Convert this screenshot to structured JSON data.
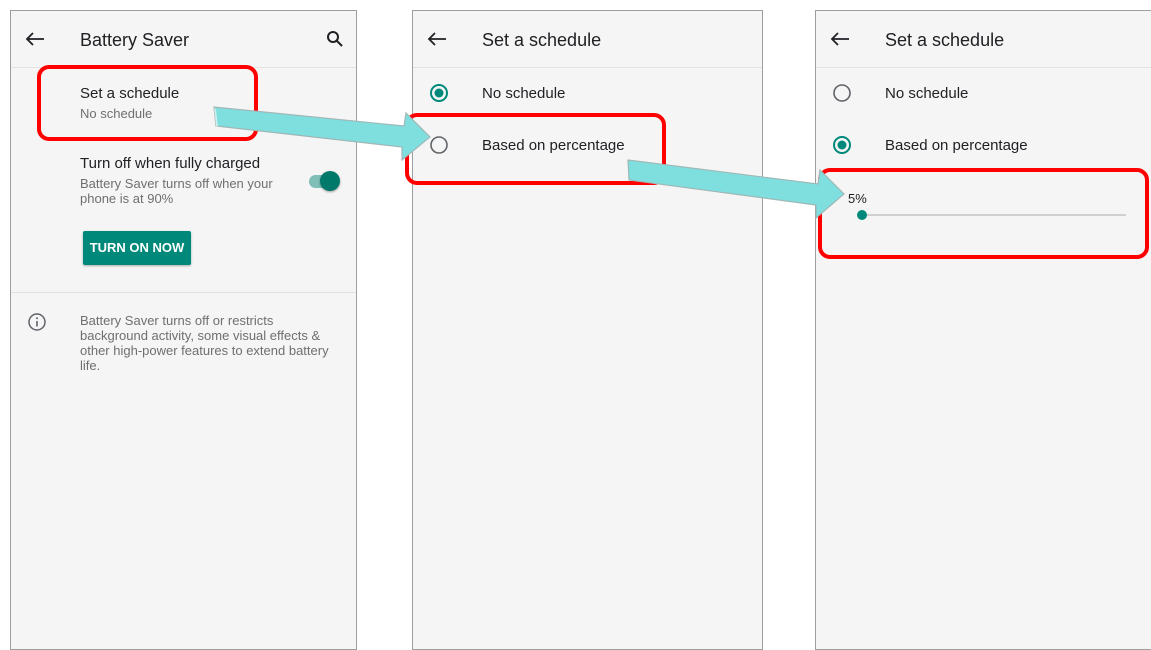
{
  "battery_saver_screen": {
    "title": "Battery Saver",
    "schedule": {
      "title": "Set a schedule",
      "summary": "No schedule"
    },
    "auto_off": {
      "title": "Turn off when fully charged",
      "summary": "Battery Saver turns off when your phone is at 90%",
      "enabled": true
    },
    "turn_on_button": "TURN ON NOW",
    "footer_info": "Battery Saver turns off or restricts background activity, some visual effects & other high-power features to extend battery life."
  },
  "schedule_screen_1": {
    "title": "Set a schedule",
    "options": [
      {
        "label": "No schedule",
        "selected": true
      },
      {
        "label": "Based on percentage",
        "selected": false
      }
    ]
  },
  "schedule_screen_2": {
    "title": "Set a schedule",
    "options": [
      {
        "label": "No schedule",
        "selected": false
      },
      {
        "label": "Based on percentage",
        "selected": true
      }
    ],
    "slider": {
      "value_label": "5%",
      "value": 5
    }
  },
  "colors": {
    "accent": "#00897b",
    "highlight": "#ff0000",
    "arrow": "#7fdfdf"
  }
}
